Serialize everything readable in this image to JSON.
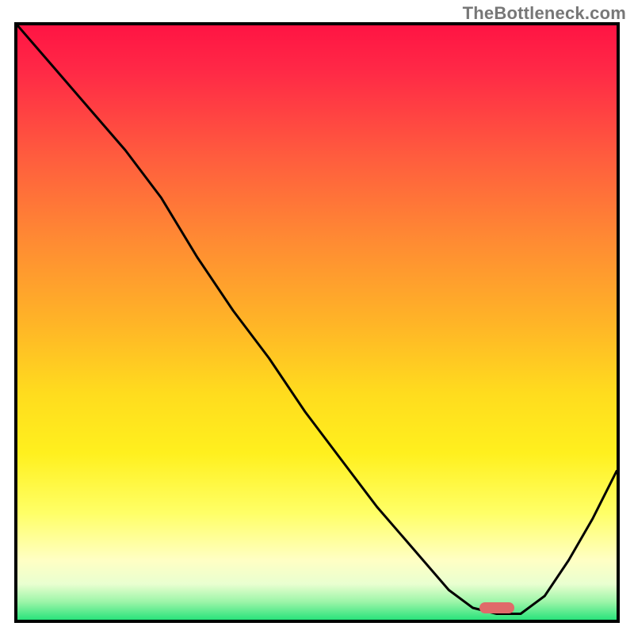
{
  "watermark": "TheBottleneck.com",
  "chart_data": {
    "type": "line",
    "title": "",
    "xlabel": "",
    "ylabel": "",
    "xlim": [
      0,
      100
    ],
    "ylim": [
      0,
      100
    ],
    "grid": false,
    "series": [
      {
        "name": "curve",
        "x": [
          0,
          6,
          12,
          18,
          24,
          30,
          36,
          42,
          48,
          54,
          60,
          66,
          72,
          76,
          80,
          84,
          88,
          92,
          96,
          100
        ],
        "y": [
          100,
          93,
          86,
          79,
          71,
          61,
          52,
          44,
          35,
          27,
          19,
          12,
          5,
          2,
          1,
          1,
          4,
          10,
          17,
          25
        ]
      }
    ],
    "marker": {
      "x": 80,
      "y": 2,
      "color": "#e06a6a"
    }
  }
}
